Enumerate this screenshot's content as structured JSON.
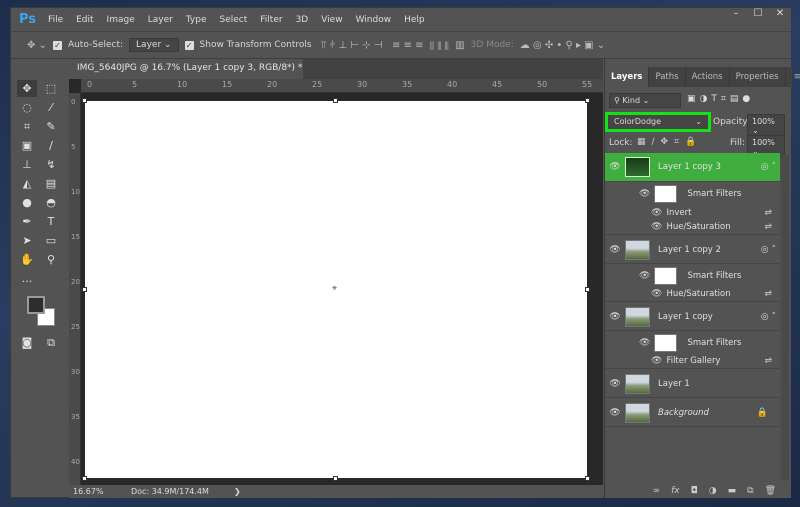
{
  "app": {
    "logo": "Ps"
  },
  "menu": [
    "File",
    "Edit",
    "Image",
    "Layer",
    "Type",
    "Select",
    "Filter",
    "3D",
    "View",
    "Window",
    "Help"
  ],
  "window_controls": {
    "minimize": "–",
    "maximize": "☐",
    "close": "✕"
  },
  "options": {
    "auto_select_label": "Auto-Select:",
    "auto_select_checked": true,
    "auto_select_target": "Layer",
    "show_transform_label": "Show Transform Controls",
    "show_transform_checked": true,
    "mode_3d_label": "3D Mode:"
  },
  "document": {
    "tab_title": "IMG_5640JPG @ 16.7% (Layer 1 copy 3, RGB/8*) *",
    "close": "×",
    "ruler_top": [
      "0",
      "5",
      "10",
      "15",
      "20",
      "25",
      "30",
      "35",
      "40",
      "45",
      "50",
      "55"
    ],
    "ruler_left": [
      "0",
      "5",
      "10",
      "15",
      "20",
      "25",
      "30",
      "35",
      "40"
    ],
    "zoom": "16.67%",
    "doc_info": "Doc: 34.9M/174.4M",
    "arrow": "❯"
  },
  "panel": {
    "tabs": [
      "Layers",
      "Paths",
      "Actions",
      "Properties"
    ],
    "filter_kind": "Kind",
    "blend_mode": "ColorDodge",
    "opacity_label": "Opacity:",
    "opacity": "100%",
    "lock_label": "Lock:",
    "fill_label": "Fill:",
    "fill": "100%",
    "layers": [
      {
        "name": "Layer 1 copy 3",
        "selected": true,
        "smart_filters": "Smart Filters",
        "filters": [
          "Invert",
          "Hue/Saturation"
        ]
      },
      {
        "name": "Layer 1 copy 2",
        "smart_filters": "Smart Filters",
        "filters": [
          "Hue/Saturation"
        ]
      },
      {
        "name": "Layer 1 copy",
        "smart_filters": "Smart Filters",
        "filters": [
          "Filter Gallery"
        ]
      },
      {
        "name": "Layer 1"
      },
      {
        "name": "Background",
        "locked": true
      }
    ]
  },
  "colors": {
    "accent_green": "#3fae3f",
    "highlight_border": "#16e016"
  }
}
